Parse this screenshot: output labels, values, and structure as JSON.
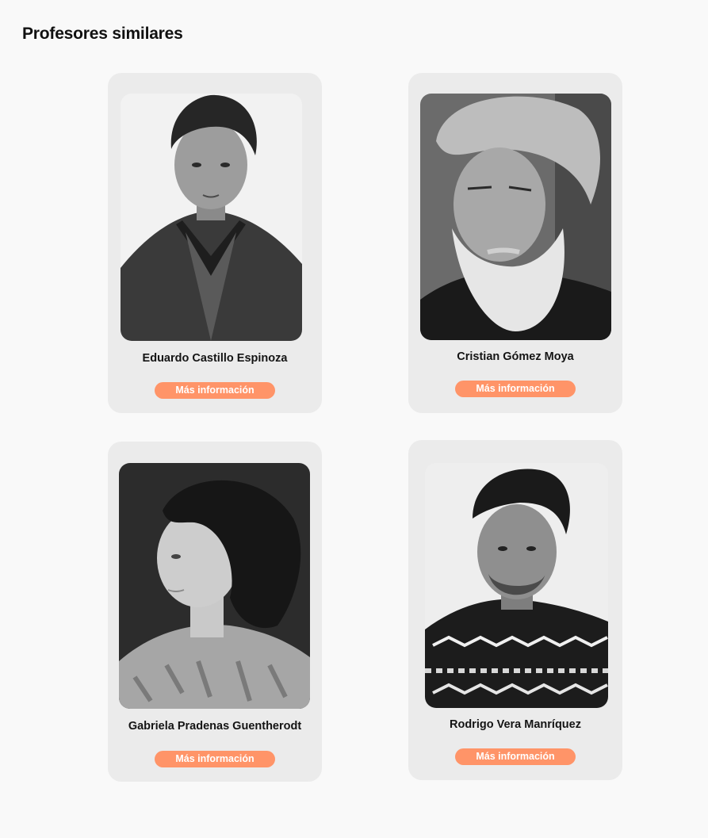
{
  "section": {
    "title": "Profesores similares"
  },
  "accent_color": "#ff9468",
  "professors": [
    {
      "name": "Eduardo Castillo Espinoza",
      "button_label": "Más información",
      "photo": "portrait-photo"
    },
    {
      "name": "Cristian Gómez Moya",
      "button_label": "Más información",
      "photo": "portrait-photo"
    },
    {
      "name": "Gabriela Pradenas Guentherodt",
      "button_label": "Más información",
      "photo": "portrait-photo"
    },
    {
      "name": "Rodrigo Vera Manríquez",
      "button_label": "Más información",
      "photo": "portrait-photo"
    }
  ]
}
